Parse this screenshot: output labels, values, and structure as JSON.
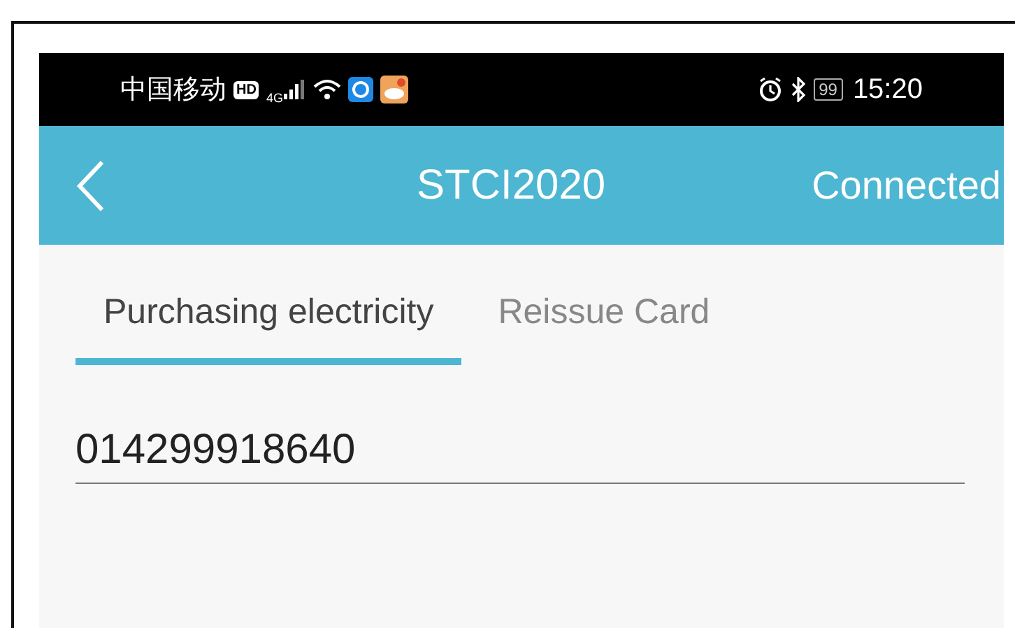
{
  "status_bar": {
    "carrier": "中国移动",
    "hd_badge": "HD",
    "network": "4G",
    "battery": "99",
    "time": "15:20"
  },
  "header": {
    "title": "STCI2020",
    "status": "Connected"
  },
  "tabs": [
    {
      "label": "Purchasing electricity",
      "selected": true
    },
    {
      "label": "Reissue Card",
      "selected": false
    }
  ],
  "meter_field": {
    "value": "014299918640"
  }
}
